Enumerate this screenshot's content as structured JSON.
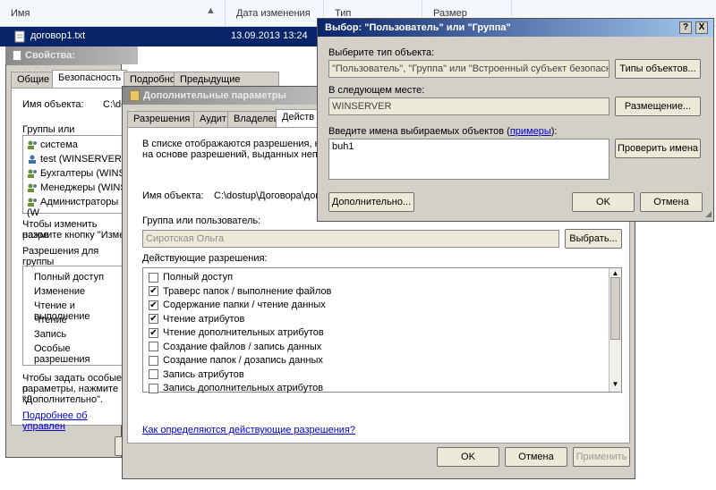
{
  "explorer": {
    "columns": [
      "Имя",
      "Дата изменения",
      "Тип",
      "Размер"
    ],
    "file": {
      "name": "договор1.txt",
      "date": "13.09.2013 13:24"
    }
  },
  "props": {
    "title": "Свойства: договор1.txt",
    "tabs": [
      "Общие",
      "Безопасность",
      "Подробно",
      "Предыдущие версии"
    ],
    "object_label": "Имя объекта:",
    "object_value": "C:\\do",
    "groups_label": "Группы или пользовате",
    "users": [
      "система",
      "test (WINSERVER\\",
      "Бухгалтеры (WINS",
      "Менеджеры (WINS",
      "Администраторы (W"
    ],
    "change_text_1": "Чтобы изменить разре",
    "change_text_2": "нажмите кнопку \"Изме",
    "perms_label": "Разрешения для группы",
    "perms": [
      "Полный доступ",
      "Изменение",
      "Чтение и выполнение",
      "Чтение",
      "Запись",
      "Особые разрешения"
    ],
    "special_text_1": "Чтобы задать особые р",
    "special_text_2": "параметры, нажмите кн",
    "special_text_3": "\"Дополнительно\".",
    "more_link": "Подробнее об управлен"
  },
  "adv": {
    "title": "Дополнительные параметры безопа",
    "tabs": [
      "Разрешения",
      "Аудит",
      "Владелец",
      "Действ"
    ],
    "info_1": "В списке отображаются разрешения, кот",
    "info_2": "на основе разрешений, выданных непоср",
    "object_label": "Имя объекта:",
    "object_value": "C:\\dostup\\Договора\\дог",
    "group_label": "Группа или пользователь:",
    "group_value": "Сиротская Ольга",
    "select_btn": "Выбрать...",
    "effective_label": "Действующие разрешения:",
    "permissions": [
      {
        "label": "Полный доступ",
        "checked": ""
      },
      {
        "label": "Траверс папок / выполнение файлов",
        "checked": "✔"
      },
      {
        "label": "Содержание папки / чтение данных",
        "checked": "✔"
      },
      {
        "label": "Чтение атрибутов",
        "checked": "✔"
      },
      {
        "label": "Чтение дополнительных атрибутов",
        "checked": "✔"
      },
      {
        "label": "Создание файлов / запись данных",
        "checked": ""
      },
      {
        "label": "Создание папок / дозапись данных",
        "checked": ""
      },
      {
        "label": "Запись атрибутов",
        "checked": ""
      },
      {
        "label": "Запись дополнительных атрибутов",
        "checked": ""
      }
    ],
    "help_link": "Как определяются действующие разрешения?",
    "ok": "OK",
    "cancel": "Отмена",
    "apply": "Применить"
  },
  "pick": {
    "title": "Выбор: \"Пользователь\" или \"Группа\"",
    "help_btn": "?",
    "close_btn": "X",
    "type_label": "Выберите тип объекта:",
    "type_value": "\"Пользователь\", \"Группа\" или \"Встроенный субъект безопаснос",
    "types_btn": "Типы объектов...",
    "location_label": "В следующем месте:",
    "location_value": "WINSERVER",
    "location_btn": "Размещение...",
    "names_label_1": "Введите имена выбираемых объектов (",
    "names_link": "примеры",
    "names_label_2": "):",
    "names_value": "buh1",
    "check_btn": "Проверить имена",
    "advanced_btn": "Дополнительно...",
    "ok": "OK",
    "cancel": "Отмена"
  }
}
